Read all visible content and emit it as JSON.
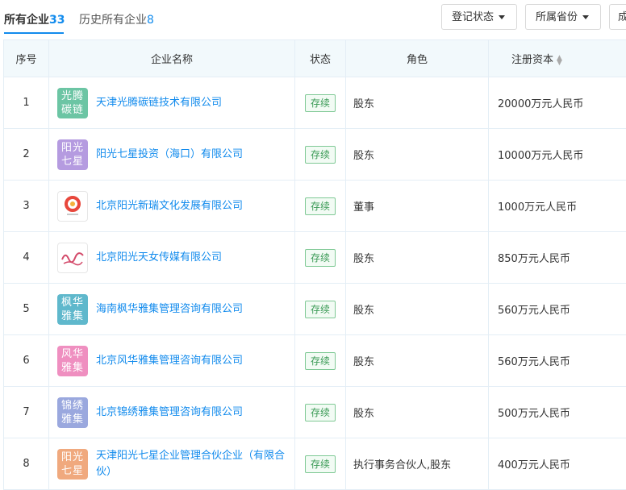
{
  "tabs": {
    "active": {
      "label": "所有企业",
      "count": "33"
    },
    "history": {
      "label": "历史所有企业",
      "count": "8"
    }
  },
  "filters": {
    "status_label": "登记状态",
    "province_label": "所属省份",
    "third_label": "成"
  },
  "table": {
    "headers": {
      "seq": "序号",
      "name": "企业名称",
      "status": "状态",
      "role": "角色",
      "capital": "注册资本"
    },
    "rows": [
      {
        "seq": "1",
        "logo_text": "光腾碳链",
        "logo_color": "#6cc5a4",
        "name": "天津光腾碳链技术有限公司",
        "status": "存续",
        "role": "股东",
        "capital": "20000万元人民币"
      },
      {
        "seq": "2",
        "logo_text": "阳光七星",
        "logo_color": "#b59be0",
        "name": "阳光七星投资（海口）有限公司",
        "status": "存续",
        "role": "股东",
        "capital": "10000万元人民币"
      },
      {
        "seq": "3",
        "logo_text": "",
        "logo_color": "#ffffff",
        "name": "北京阳光新瑞文化发展有限公司",
        "status": "存续",
        "role": "董事",
        "capital": "1000万元人民币"
      },
      {
        "seq": "4",
        "logo_text": "",
        "logo_color": "#ffffff",
        "name": "北京阳光天女传媒有限公司",
        "status": "存续",
        "role": "股东",
        "capital": "850万元人民币"
      },
      {
        "seq": "5",
        "logo_text": "枫华雅集",
        "logo_color": "#5fb8cc",
        "name": "海南枫华雅集管理咨询有限公司",
        "status": "存续",
        "role": "股东",
        "capital": "560万元人民币"
      },
      {
        "seq": "6",
        "logo_text": "风华雅集",
        "logo_color": "#ef8fc0",
        "name": "北京风华雅集管理咨询有限公司",
        "status": "存续",
        "role": "股东",
        "capital": "560万元人民币"
      },
      {
        "seq": "7",
        "logo_text": "锦绣雅集",
        "logo_color": "#9aa8de",
        "name": "北京锦绣雅集管理咨询有限公司",
        "status": "存续",
        "role": "股东",
        "capital": "500万元人民币"
      },
      {
        "seq": "8",
        "logo_text": "阳光七星",
        "logo_color": "#f0a97e",
        "name": "天津阳光七星企业管理合伙企业（有限合伙）",
        "status": "存续",
        "role": "执行事务合伙人,股东",
        "capital": "400万元人民币"
      }
    ]
  }
}
